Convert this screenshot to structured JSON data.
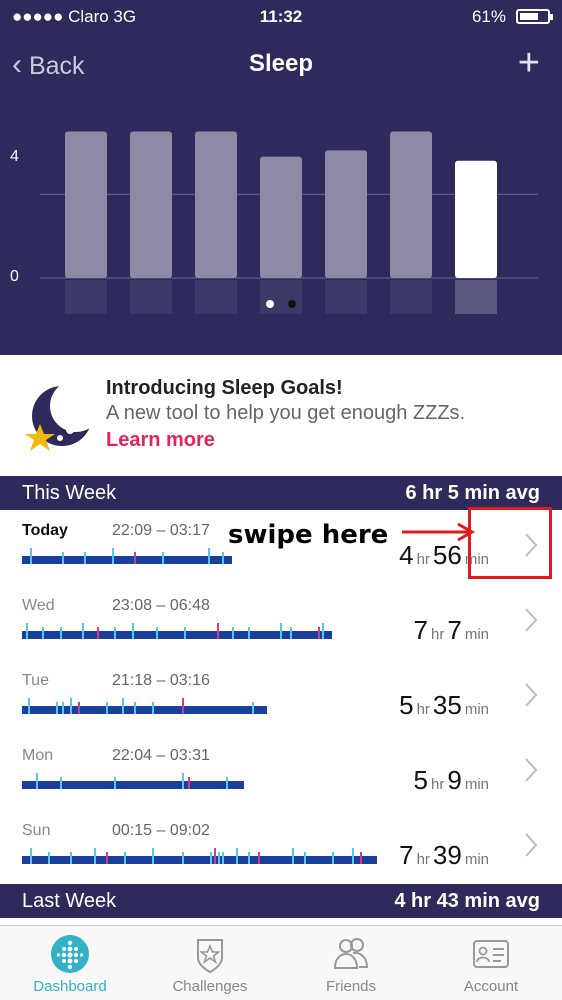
{
  "status": {
    "carrier": "●●●●● Claro   3G",
    "time": "11:32",
    "battery": "61%"
  },
  "nav": {
    "back": "Back",
    "title": "Sleep",
    "add": "+"
  },
  "chart_data": {
    "type": "bar",
    "categories": [
      "",
      "",
      "",
      "",
      "",
      "",
      ""
    ],
    "values": [
      7.0,
      7.0,
      7.0,
      5.8,
      6.1,
      7.0,
      5.6
    ],
    "ylim": [
      0,
      8.6
    ],
    "y_ticks": [
      "0",
      "4"
    ],
    "highlight_index": 6,
    "grid": true
  },
  "promo": {
    "title": "Introducing Sleep Goals!",
    "text": "A new tool to help you get enough ZZZs.",
    "link": "Learn more"
  },
  "this_week": {
    "label": "This Week",
    "avg": "6 hr 5 min avg",
    "rows": [
      {
        "day": "Today",
        "range": "22:09 – 03:17",
        "hr": "4",
        "min": "56"
      },
      {
        "day": "Wed",
        "range": "23:08 – 06:48",
        "hr": "7",
        "min": "7"
      },
      {
        "day": "Tue",
        "range": "21:18 – 03:16",
        "hr": "5",
        "min": "35"
      },
      {
        "day": "Mon",
        "range": "22:04 – 03:31",
        "hr": "5",
        "min": "9"
      },
      {
        "day": "Sun",
        "range": "00:15 – 09:02",
        "hr": "7",
        "min": "39"
      }
    ],
    "hr_unit": "hr",
    "min_unit": "min"
  },
  "last_week": {
    "label": "Last Week",
    "avg": "4 hr 43 min avg"
  },
  "annotation": {
    "text": "swipe here"
  },
  "tabs": [
    {
      "label": "Dashboard",
      "icon": "dashboard-icon"
    },
    {
      "label": "Challenges",
      "icon": "challenges-icon"
    },
    {
      "label": "Friends",
      "icon": "friends-icon"
    },
    {
      "label": "Account",
      "icon": "account-icon"
    }
  ],
  "colors": {
    "header": "#2e2a5c",
    "accent": "#32b2c7",
    "link": "#e5245e",
    "bar_sleep": "#1a3f9e",
    "bar_awake": "#58c8ea"
  }
}
